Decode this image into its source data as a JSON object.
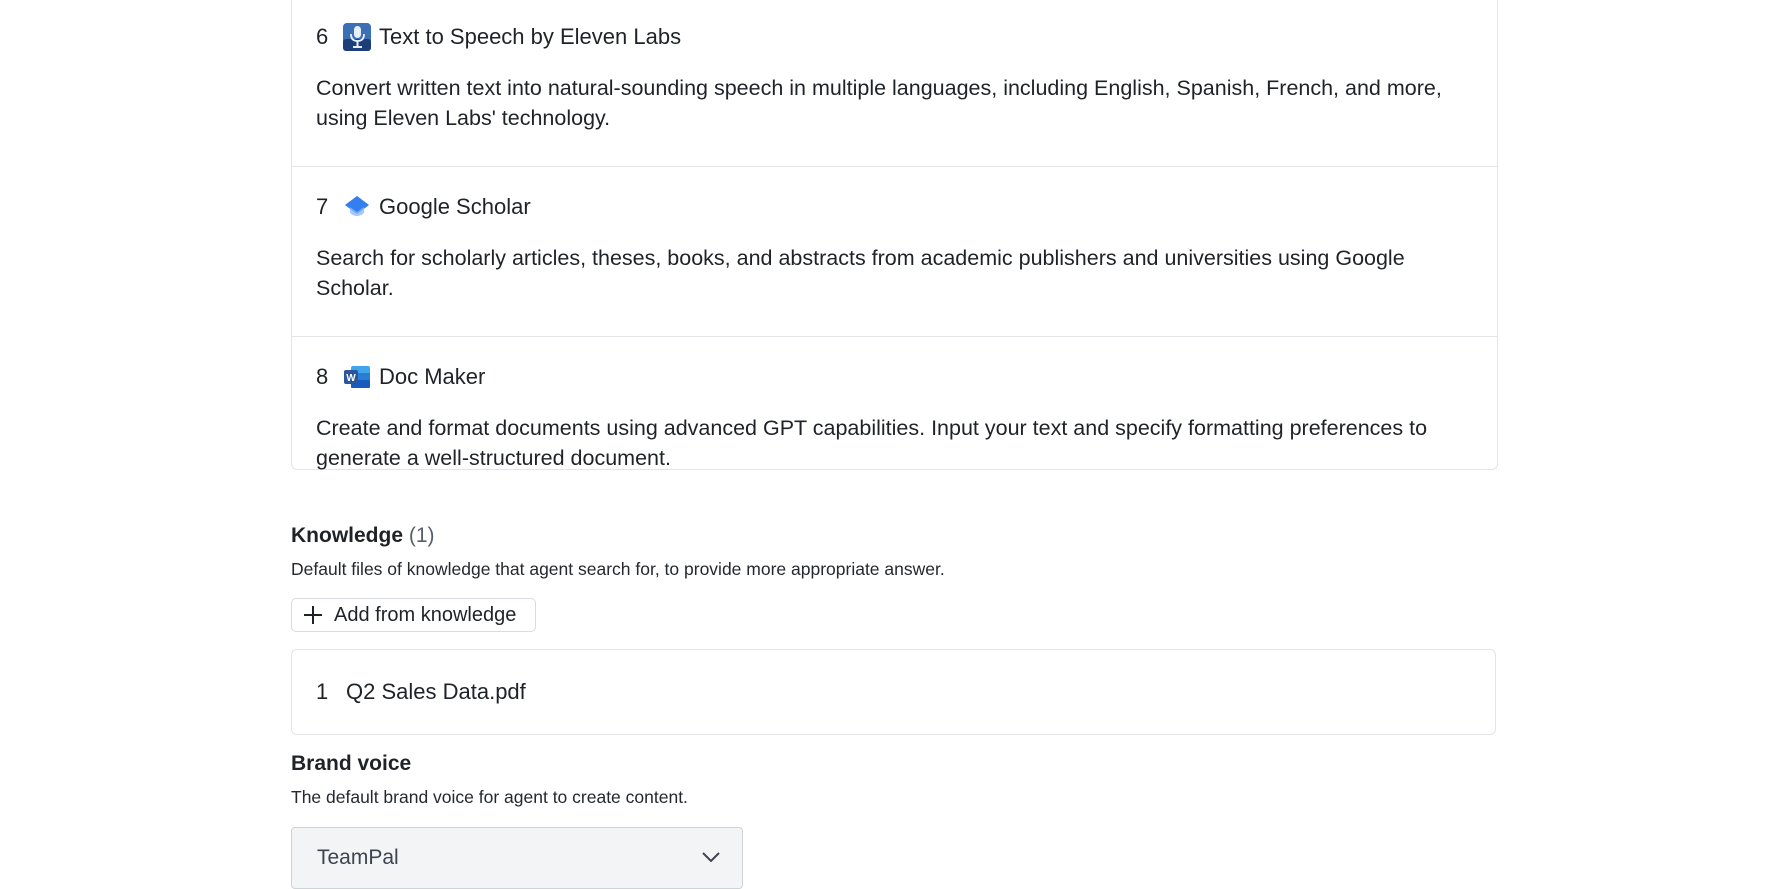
{
  "tools": [
    {
      "number": "6",
      "icon": "microphone-app-icon",
      "name": "Text to Speech by Eleven Labs",
      "description": "Convert written text into natural-sounding speech in multiple languages, including English, Spanish, French, and more, using Eleven Labs' technology."
    },
    {
      "number": "7",
      "icon": "graduation-cap-icon",
      "name": "Google Scholar",
      "description": "Search for scholarly articles, theses, books, and abstracts from academic publishers and universities using Google Scholar."
    },
    {
      "number": "8",
      "icon": "word-document-icon",
      "name": "Doc Maker",
      "description": "Create and format documents using advanced GPT capabilities. Input your text and specify formatting preferences to generate a well-structured document."
    }
  ],
  "knowledge": {
    "title": "Knowledge",
    "count": "(1)",
    "subtitle": "Default files of knowledge that agent search for, to provide more appropriate answer.",
    "add_label": "Add from knowledge",
    "files": [
      {
        "number": "1",
        "name": "Q2 Sales Data.pdf"
      }
    ]
  },
  "brand_voice": {
    "title": "Brand voice",
    "subtitle": "The default brand voice for agent to create content.",
    "selected": "TeamPal"
  },
  "colors": {
    "border": "#e3e5e8",
    "text": "#1f2328",
    "select_bg": "#f3f4f6",
    "scholar_blue": "#4285f4",
    "word_blue": "#2b579a"
  }
}
